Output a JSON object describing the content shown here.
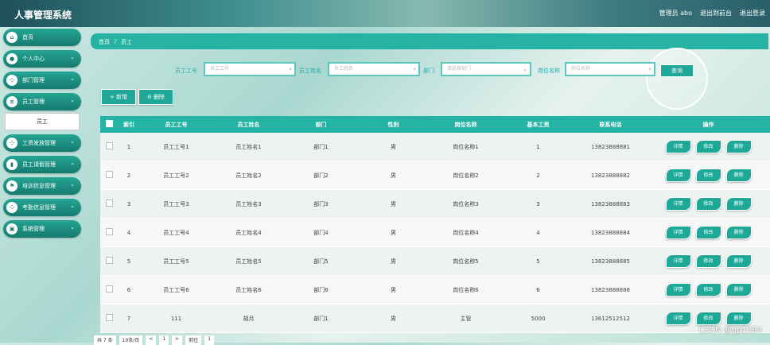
{
  "app": {
    "title": "人事管理系统"
  },
  "top_links": [
    "管理员 abo",
    "退出到前台",
    "退出登录"
  ],
  "sidebar": {
    "items": [
      {
        "label": "首页",
        "icon": "home-icon",
        "chev": false
      },
      {
        "label": "个人中心",
        "icon": "user-icon",
        "chev": true
      },
      {
        "label": "部门管理",
        "icon": "dots-icon",
        "chev": true
      },
      {
        "label": "员工管理",
        "icon": "list-icon",
        "chev": true
      },
      {
        "label": "工资发放管理",
        "icon": "dots-icon",
        "chev": true
      },
      {
        "label": "员工请假管理",
        "icon": "chart-icon",
        "chev": true
      },
      {
        "label": "培训信息管理",
        "icon": "flag-icon",
        "chev": true
      },
      {
        "label": "考勤信息管理",
        "icon": "dots-icon",
        "chev": true
      },
      {
        "label": "系统管理",
        "icon": "lock-icon",
        "chev": true
      }
    ],
    "sub_item": "员工"
  },
  "breadcrumb": {
    "home": "首页",
    "sep": "/",
    "current": "员工"
  },
  "search": {
    "f1_label": "员工工号",
    "f1_placeholder": "员工工号",
    "f2_label": "员工姓名",
    "f2_placeholder": "员工姓名",
    "f3_label": "部门",
    "f3_placeholder": "请选择部门",
    "f4_label": "岗位名称",
    "f4_placeholder": "岗位名称",
    "query": "查询"
  },
  "actions": {
    "add": "+ 新增",
    "delete": "⊖ 删除"
  },
  "table": {
    "headers": [
      "",
      "索引",
      "员工工号",
      "员工姓名",
      "部门",
      "性别",
      "岗位名称",
      "基本工资",
      "联系电话",
      "操作"
    ],
    "rows": [
      [
        "1",
        "员工工号1",
        "员工姓名1",
        "部门1",
        "男",
        "岗位名称1",
        "1",
        "13823888881"
      ],
      [
        "2",
        "员工工号2",
        "员工姓名2",
        "部门2",
        "男",
        "岗位名称2",
        "2",
        "13823888882"
      ],
      [
        "3",
        "员工工号3",
        "员工姓名3",
        "部门3",
        "男",
        "岗位名称3",
        "3",
        "13823888883"
      ],
      [
        "4",
        "员工工号4",
        "员工姓名4",
        "部门4",
        "男",
        "岗位名称4",
        "4",
        "13823888884"
      ],
      [
        "5",
        "员工工号5",
        "员工姓名5",
        "部门5",
        "男",
        "岗位名称5",
        "5",
        "13823888885"
      ],
      [
        "6",
        "员工工号6",
        "员工姓名6",
        "部门6",
        "男",
        "岗位名称6",
        "6",
        "13823888886"
      ],
      [
        "7",
        "111",
        "胡月",
        "部门1",
        "男",
        "主管",
        "5000",
        "13612512512"
      ]
    ],
    "ops": [
      "详情",
      "修改",
      "删除"
    ]
  },
  "pager": {
    "total": "共 7 条",
    "size": "10条/页",
    "prev": "<",
    "page": "1",
    "next": ">",
    "goto": "前往",
    "goto_page": "1"
  },
  "watermark": "CSDN @gp1084",
  "colors": {
    "accent": "#24b3a4"
  }
}
